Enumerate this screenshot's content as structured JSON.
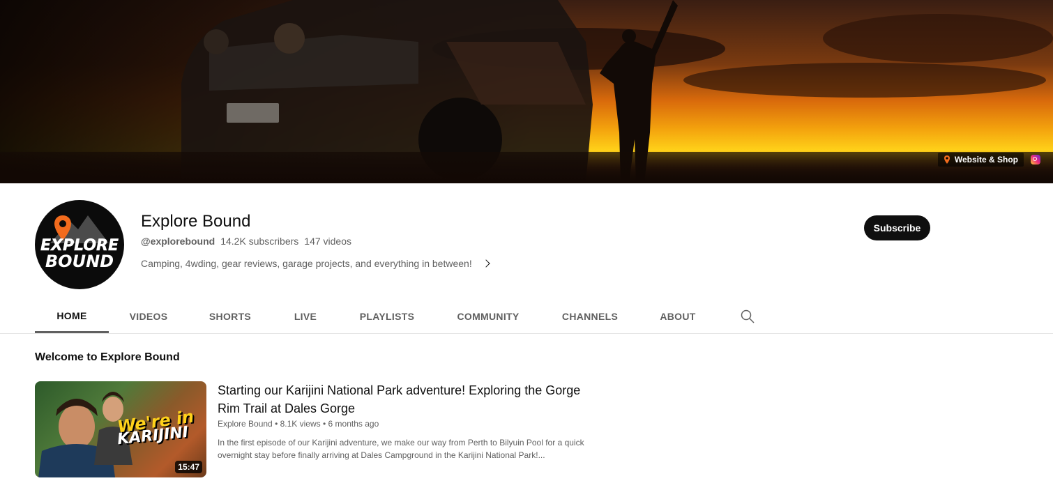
{
  "banner": {
    "links": [
      {
        "label": "Website & Shop",
        "icon": "link-favicon-icon"
      },
      {
        "label": "",
        "icon": "instagram-icon"
      }
    ]
  },
  "channel": {
    "name": "Explore Bound",
    "handle": "@explorebound",
    "subscribers": "14.2K subscribers",
    "videos": "147 videos",
    "description": "Camping, 4wding, gear reviews, garage projects, and everything in between!",
    "avatar_text_1": "EXPLORE",
    "avatar_text_2": "BOUND",
    "subscribe_label": "Subscribe"
  },
  "tabs": [
    {
      "label": "HOME",
      "active": true
    },
    {
      "label": "VIDEOS",
      "active": false
    },
    {
      "label": "SHORTS",
      "active": false
    },
    {
      "label": "LIVE",
      "active": false
    },
    {
      "label": "PLAYLISTS",
      "active": false
    },
    {
      "label": "COMMUNITY",
      "active": false
    },
    {
      "label": "CHANNELS",
      "active": false
    },
    {
      "label": "ABOUT",
      "active": false
    }
  ],
  "section": {
    "title": "Welcome to Explore Bound"
  },
  "featured_video": {
    "title": "Starting our Karijini National Park adventure! Exploring the Gorge Rim Trail at Dales Gorge",
    "channel": "Explore Bound",
    "views": "8.1K views",
    "age": "6 months ago",
    "separator": "•",
    "description": "In the first episode of our Karijini adventure, we make our way from Perth to Bilyuin Pool for a quick overnight stay before finally arriving at Dales Campground in the Karijini National Park!...",
    "duration": "15:47",
    "thumb_text_1": "We're in",
    "thumb_text_2": "KARIJINI"
  },
  "colors": {
    "text_primary": "#0f0f0f",
    "text_secondary": "#606060",
    "subscribe_bg": "#0f0f0f",
    "avatar_accent": "#f26b1d"
  }
}
